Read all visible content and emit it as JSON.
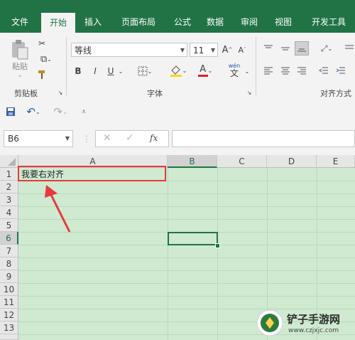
{
  "tabs": [
    "文件",
    "开始",
    "插入",
    "页面布局",
    "公式",
    "数据",
    "审阅",
    "视图",
    "开发工具"
  ],
  "clipboard": {
    "paste_label": "粘贴",
    "group_label": "剪贴板"
  },
  "font": {
    "name": "等线",
    "size": "11",
    "group_label": "字体",
    "bold": "B",
    "italic": "I",
    "underline": "U",
    "grow": "A",
    "shrink": "A",
    "font_color_letter": "A",
    "phonetic": "wén",
    "phonetic_char": "文"
  },
  "alignment": {
    "group_label": "对齐方式"
  },
  "formula_bar": {
    "name_box": "B6",
    "fx": "fx"
  },
  "columns": [
    "A",
    "B",
    "C",
    "D",
    "E"
  ],
  "rows": [
    "1",
    "2",
    "3",
    "4",
    "5",
    "6",
    "7",
    "8",
    "9",
    "10",
    "11",
    "12",
    "13"
  ],
  "cells": {
    "A1": "我要右对齐"
  },
  "colors": {
    "brand": "#217346",
    "annotation": "#e8393a",
    "sheet_tint": "#cfead1"
  },
  "watermark": {
    "title": "铲子手游网",
    "url": "www.czjxjc.com"
  }
}
